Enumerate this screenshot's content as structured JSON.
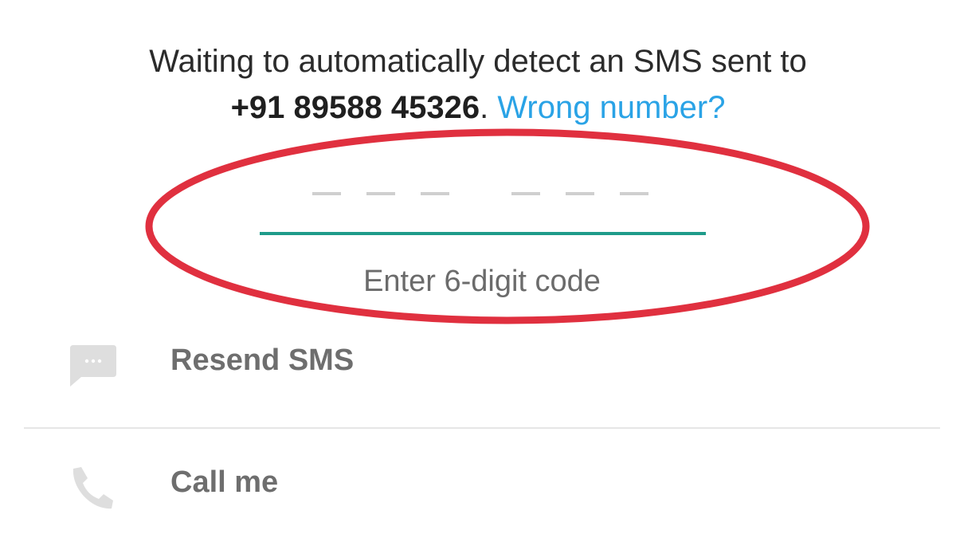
{
  "verify": {
    "message": "Waiting to automatically detect an SMS sent to",
    "phone_number": "+91 89588 45326",
    "period": ".",
    "wrong_number_link": "Wrong number?",
    "code_hint": "Enter 6-digit code",
    "code_length": 6,
    "accent_color": "#1f9b8a",
    "link_color": "#2aa3e6",
    "highlight_color": "#e0303f"
  },
  "options": [
    {
      "label": "Resend SMS",
      "icon": "message-icon"
    },
    {
      "label": "Call me",
      "icon": "phone-icon"
    }
  ]
}
